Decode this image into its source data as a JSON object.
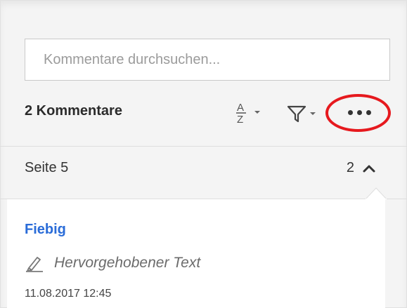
{
  "search": {
    "placeholder": "Kommentare durchsuchen..."
  },
  "toolbar": {
    "count_label": "2 Kommentare",
    "sort_icon": "sort-az-icon",
    "filter_icon": "filter-icon",
    "more_icon": "more-options-icon"
  },
  "page_group": {
    "label": "Seite 5",
    "count": "2",
    "state_icon": "chevron-up-icon"
  },
  "comment": {
    "author": "Fiebig",
    "type_icon": "highlight-pen-icon",
    "type": "Hervorgehobener Text",
    "date": "11.08.2017  12:45"
  },
  "colors": {
    "author": "#2a6cd8",
    "annotation_ring": "#e6191e"
  }
}
